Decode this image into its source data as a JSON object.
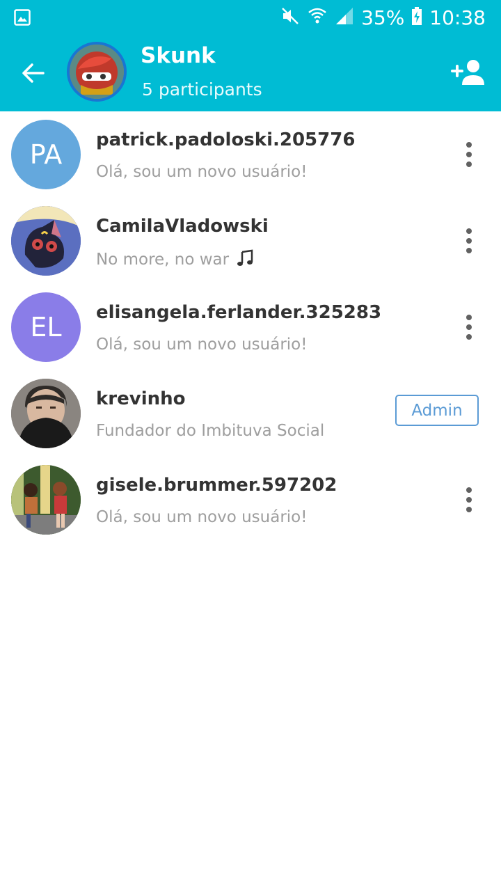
{
  "status_bar": {
    "battery": "35%",
    "time": "10:38",
    "icons": [
      "gallery-icon",
      "mute-icon",
      "wifi-icon",
      "signal-icon",
      "battery-charging-icon"
    ]
  },
  "header": {
    "title": "Skunk",
    "subtitle": "5 participants",
    "back_icon": "arrow-back-icon",
    "add_icon": "add-person-icon",
    "color": "#00bcd4"
  },
  "participants": [
    {
      "name": "patrick.padoloski.205776",
      "status": "Olá, sou um novo usuário!",
      "initials": "PA",
      "avatar_color": "#64a8dd",
      "role": ""
    },
    {
      "name": "CamilaVladowski",
      "status": "No more, no war",
      "status_icon": "music-note-icon",
      "initials": "",
      "avatar": "cartoon-cat-image",
      "role": ""
    },
    {
      "name": "elisangela.ferlander.325283",
      "status": "Olá, sou um novo usuário!",
      "initials": "EL",
      "avatar_color": "#8a7de8",
      "role": ""
    },
    {
      "name": "krevinho",
      "status": "Fundador do Imbituva Social",
      "initials": "",
      "avatar": "masked-person-photo",
      "role": "Admin"
    },
    {
      "name": "gisele.brummer.597202",
      "status": "Olá, sou um novo usuário!",
      "initials": "",
      "avatar": "anime-couple-image",
      "role": ""
    }
  ]
}
